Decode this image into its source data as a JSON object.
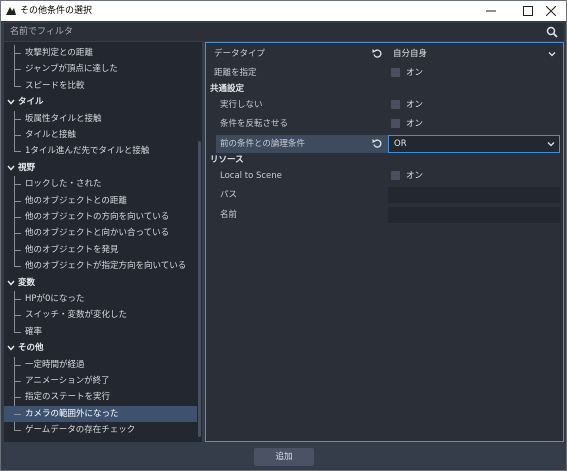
{
  "window": {
    "title": "その他条件の選択"
  },
  "filter": {
    "placeholder": "名前でフィルタ"
  },
  "tree": {
    "rows": [
      {
        "label": "攻撃判定との距離",
        "kind": "item"
      },
      {
        "label": "ジャンプが頂点に達した",
        "kind": "item"
      },
      {
        "label": "スピードを比較",
        "kind": "item"
      },
      {
        "label": "タイル",
        "kind": "category"
      },
      {
        "label": "坂属性タイルと接触",
        "kind": "item"
      },
      {
        "label": "タイルと接触",
        "kind": "item"
      },
      {
        "label": "1タイル進んだ先でタイルと接触",
        "kind": "item"
      },
      {
        "label": "視野",
        "kind": "category"
      },
      {
        "label": "ロックした・された",
        "kind": "item"
      },
      {
        "label": "他のオブジェクトとの距離",
        "kind": "item"
      },
      {
        "label": "他のオブジェクトの方向を向いている",
        "kind": "item"
      },
      {
        "label": "他のオブジェクトと向かい合っている",
        "kind": "item"
      },
      {
        "label": "他のオブジェクトを発見",
        "kind": "item"
      },
      {
        "label": "他のオブジェクトが指定方向を向いている",
        "kind": "item"
      },
      {
        "label": "変数",
        "kind": "category"
      },
      {
        "label": "HPが0になった",
        "kind": "item"
      },
      {
        "label": "スイッチ・変数が変化した",
        "kind": "item"
      },
      {
        "label": "確率",
        "kind": "item"
      },
      {
        "label": "その他",
        "kind": "category"
      },
      {
        "label": "一定時間が経過",
        "kind": "item"
      },
      {
        "label": "アニメーションが終了",
        "kind": "item"
      },
      {
        "label": "指定のステートを実行",
        "kind": "item"
      },
      {
        "label": "カメラの範囲外になった",
        "kind": "item",
        "selected": true
      },
      {
        "label": "ゲームデータの存在チェック",
        "kind": "item"
      }
    ]
  },
  "inspector": {
    "data_type_label": "データタイプ",
    "data_type_value": "自分自身",
    "distance_label": "距離を指定",
    "distance_toggle": "オン",
    "common_section": "共通設定",
    "no_exec_label": "実行しない",
    "no_exec_toggle": "オン",
    "invert_label": "条件を反転させる",
    "invert_toggle": "オン",
    "logic_label": "前の条件との論理条件",
    "logic_value": "OR",
    "resource_section": "リソース",
    "local_label": "Local to Scene",
    "local_toggle": "オン",
    "path_label": "パス",
    "name_label": "名前"
  },
  "footer": {
    "add_label": "追加"
  },
  "colors": {
    "accent": "#4b8fd6",
    "selected": "#3e5270"
  }
}
